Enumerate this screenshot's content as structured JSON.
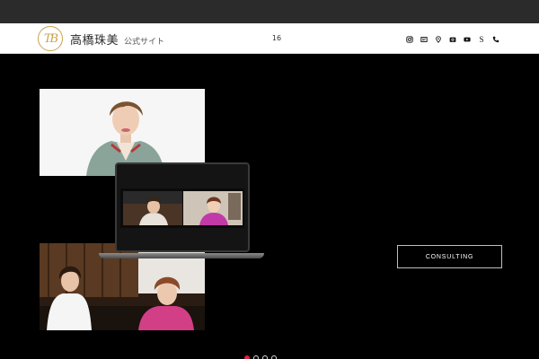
{
  "header": {
    "logo_mark": "TB",
    "logo_name": "高橋珠美",
    "logo_sub": "公式サイト",
    "center_number": "16",
    "icons": [
      "instagram-icon",
      "blog-icon",
      "location-icon",
      "camera-icon",
      "youtube-icon",
      "s-icon",
      "phone-icon"
    ],
    "s_label": "S"
  },
  "hero": {
    "cta_label": "CONSULTING"
  },
  "slider": {
    "count": 4,
    "active_index": 0
  },
  "colors": {
    "background": "#000000",
    "header_bg": "#ffffff",
    "top_bar": "#2b2b2b",
    "logo_gold": "#c9a24a",
    "active_dot": "#e0203f"
  }
}
